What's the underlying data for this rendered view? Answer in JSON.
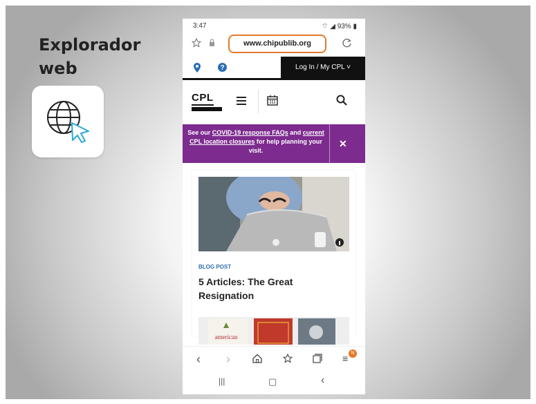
{
  "lesson": {
    "title": "Explorador web",
    "app_icon": "web-browser-globe-icon"
  },
  "status": {
    "time": "3:47",
    "battery": "93%"
  },
  "browser": {
    "url": "www.chipublib.org",
    "url_highlight_color": "#e27a2a"
  },
  "site": {
    "login_label": "Log In / My CPL",
    "logo_text": "CPL",
    "banner": {
      "pre": "See our ",
      "link1": "COVID-19 response FAQs",
      "mid": " and ",
      "link2": "current CPL location closures",
      "post": " for help planning your visit.",
      "close": "✕",
      "color": "#7d2b8f"
    },
    "card": {
      "tag": "BLOG POST",
      "headline": "5 Articles: The Great Resignation"
    }
  },
  "toolbar": {
    "tabs_badge": "N"
  }
}
